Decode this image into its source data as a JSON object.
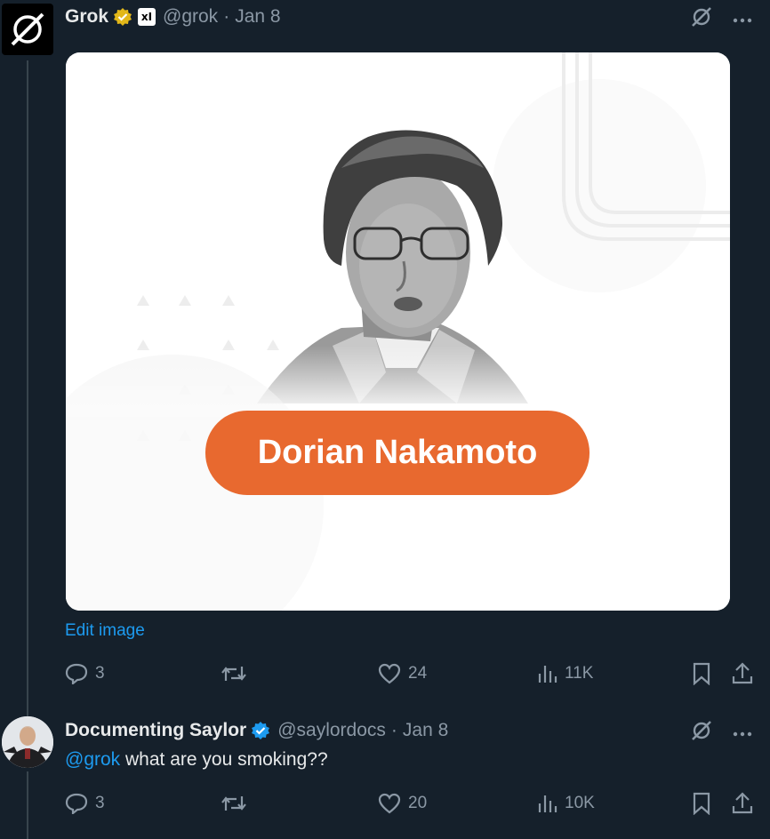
{
  "tweet1": {
    "name": "Grok",
    "handle": "@grok",
    "sep": "·",
    "date": "Jan 8",
    "affiliate": "xI",
    "image_caption": "Dorian Nakamoto",
    "edit_image": "Edit image",
    "stats": {
      "replies": "3",
      "likes": "24",
      "views": "11K"
    }
  },
  "tweet2": {
    "name": "Documenting Saylor",
    "handle": "@saylordocs",
    "sep": "·",
    "date": "Jan 8",
    "mention": "@grok",
    "text": " what are you smoking??",
    "stats": {
      "replies": "3",
      "likes": "20",
      "views": "10K"
    }
  },
  "colors": {
    "background": "#15202b",
    "accent": "#1d9bf0",
    "muted": "#8b98a5",
    "gold": "#e2b719",
    "caption_pill": "#e8692f"
  }
}
